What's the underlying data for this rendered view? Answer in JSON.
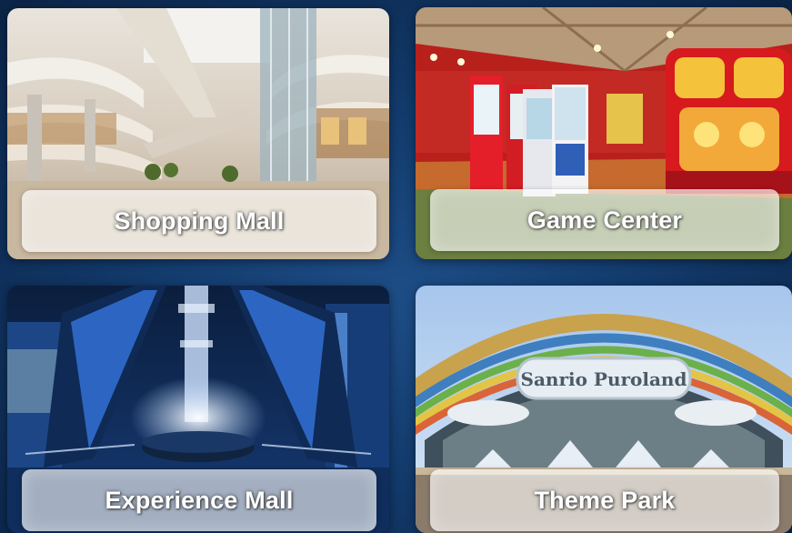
{
  "cards": [
    {
      "label": "Shopping Mall"
    },
    {
      "label": "Game Center"
    },
    {
      "label": "Experience Mall"
    },
    {
      "label": "Theme Park",
      "sign_text": "Sanrio Puroland"
    }
  ],
  "colors": {
    "background": "#123a6b",
    "label_plate": "rgba(255,255,255,0.62)",
    "label_text": "#ffffff"
  }
}
